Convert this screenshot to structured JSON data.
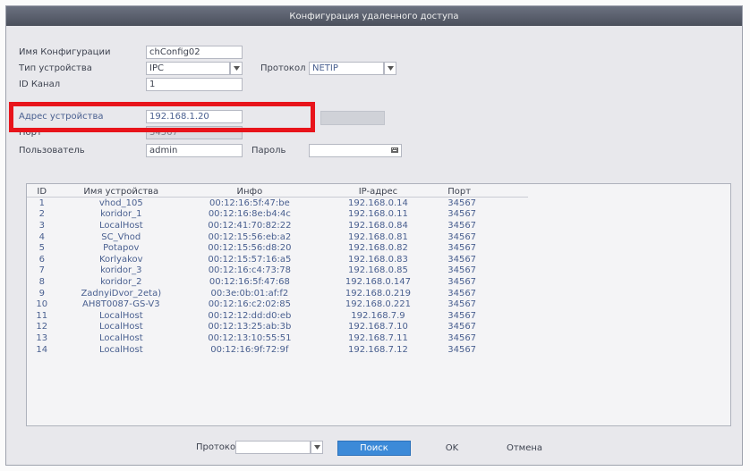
{
  "window": {
    "title": "Конфигурация удаленного доступа"
  },
  "form": {
    "config_name_label": "Имя Конфигурации",
    "config_name_value": "chConfig02",
    "device_type_label": "Тип устройства",
    "device_type_value": "IPC",
    "protocol_label": "Протокол",
    "protocol_value": "NETIP",
    "channel_label": "ID Канал",
    "channel_value": "1",
    "address_label": "Адрес устройства",
    "address_value": "192.168.1.20",
    "address_button": "",
    "port_label": "Порт",
    "port_value": "34567",
    "user_label": "Пользователь",
    "user_value": "admin",
    "password_label": "Пароль",
    "password_value": "",
    "highlight_color": "#e8141b"
  },
  "table": {
    "headers": [
      "ID",
      "Имя устройства",
      "Инфо",
      "IP-адрес",
      "Порт"
    ],
    "rows": [
      [
        "1",
        "vhod_105",
        "00:12:16:5f:47:be",
        "192.168.0.14",
        "34567"
      ],
      [
        "2",
        "koridor_1",
        "00:12:16:8e:b4:4c",
        "192.168.0.11",
        "34567"
      ],
      [
        "3",
        "LocalHost",
        "00:12:41:70:82:22",
        "192.168.0.84",
        "34567"
      ],
      [
        "4",
        "SC_Vhod",
        "00:12:15:56:eb:a2",
        "192.168.0.81",
        "34567"
      ],
      [
        "5",
        "Potapov",
        "00:12:15:56:d8:20",
        "192.168.0.82",
        "34567"
      ],
      [
        "6",
        "Korlyakov",
        "00:12:15:57:16:a5",
        "192.168.0.83",
        "34567"
      ],
      [
        "7",
        "koridor_3",
        "00:12:16:c4:73:78",
        "192.168.0.85",
        "34567"
      ],
      [
        "8",
        "koridor_2",
        "00:12:16:5f:47:68",
        "192.168.0.147",
        "34567"
      ],
      [
        "9",
        "ZadnyiDvor_2eta)",
        "00:3e:0b:01:af:f2",
        "192.168.0.219",
        "34567"
      ],
      [
        "10",
        "AH8T0087-GS-V3",
        "00:12:16:c2:02:85",
        "192.168.0.221",
        "34567"
      ],
      [
        "11",
        "LocalHost",
        "00:12:12:dd:d0:eb",
        "192.168.7.9",
        "34567"
      ],
      [
        "12",
        "LocalHost",
        "00:12:13:25:ab:3b",
        "192.168.7.10",
        "34567"
      ],
      [
        "13",
        "LocalHost",
        "00:12:13:10:55:51",
        "192.168.7.11",
        "34567"
      ],
      [
        "14",
        "LocalHost",
        "00:12:16:9f:72:9f",
        "192.168.7.12",
        "34567"
      ]
    ]
  },
  "footer": {
    "protocol_label": "Протокол",
    "protocol_value": "",
    "search_button": "Поиск",
    "ok_button": "OK",
    "cancel_button": "Отмена"
  },
  "colors": {
    "accent": "#3c8ad8",
    "title_bg": "#555a66",
    "row_text": "#4a6090"
  },
  "icons": {
    "dropdown": "chevron-down-icon"
  }
}
